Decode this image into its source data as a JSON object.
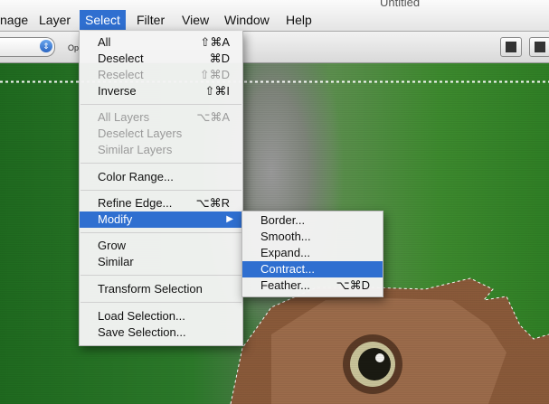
{
  "window": {
    "title": "Untitled"
  },
  "menubar": {
    "items": [
      {
        "label": "nage"
      },
      {
        "label": "Layer"
      },
      {
        "label": "Select",
        "active": true
      },
      {
        "label": "Filter"
      },
      {
        "label": "View"
      },
      {
        "label": "Window"
      },
      {
        "label": "Help"
      }
    ]
  },
  "options_bar": {
    "option_label": "Op"
  },
  "select_menu": {
    "all": {
      "label": "All",
      "shortcut": "⇧⌘A"
    },
    "deselect": {
      "label": "Deselect",
      "shortcut": "⌘D"
    },
    "reselect": {
      "label": "Reselect",
      "shortcut": "⇧⌘D"
    },
    "inverse": {
      "label": "Inverse",
      "shortcut": "⇧⌘I"
    },
    "all_layers": {
      "label": "All Layers",
      "shortcut": "⌥⌘A"
    },
    "deselect_layers": {
      "label": "Deselect Layers"
    },
    "similar_layers": {
      "label": "Similar Layers"
    },
    "color_range": {
      "label": "Color Range..."
    },
    "refine_edge": {
      "label": "Refine Edge...",
      "shortcut": "⌥⌘R"
    },
    "modify": {
      "label": "Modify",
      "arrow": "▶"
    },
    "grow": {
      "label": "Grow"
    },
    "similar": {
      "label": "Similar"
    },
    "transform_selection": {
      "label": "Transform Selection"
    },
    "load_selection": {
      "label": "Load Selection..."
    },
    "save_selection": {
      "label": "Save Selection..."
    }
  },
  "modify_submenu": {
    "border": {
      "label": "Border..."
    },
    "smooth": {
      "label": "Smooth..."
    },
    "expand": {
      "label": "Expand..."
    },
    "contract": {
      "label": "Contract..."
    },
    "feather": {
      "label": "Feather...",
      "shortcut": "⌥⌘D"
    }
  },
  "colors": {
    "highlight": "#2f6fd0",
    "disabled_text": "#9a9a9a"
  }
}
